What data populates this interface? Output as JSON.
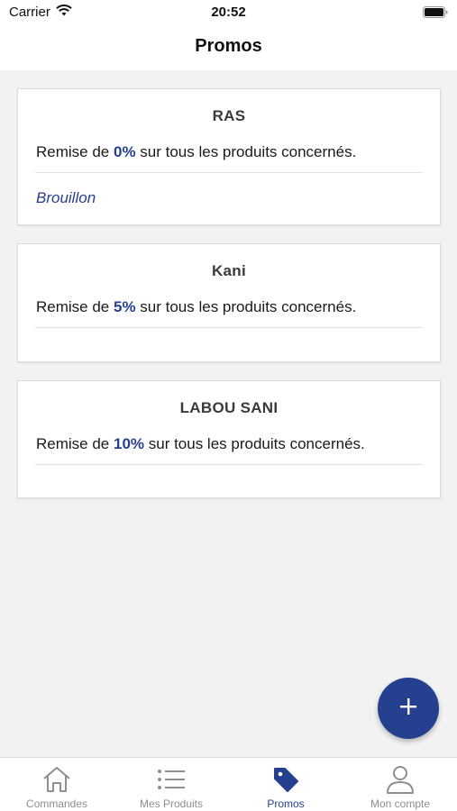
{
  "status_bar": {
    "carrier": "Carrier",
    "time": "20:52"
  },
  "header": {
    "title": "Promos"
  },
  "colors": {
    "accent": "#25408f",
    "inactive": "#8e8e93",
    "background": "#f2f2f2"
  },
  "promos": [
    {
      "name": "RAS",
      "prefix": "Remise de ",
      "percent": "0%",
      "suffix": " sur tous les produits concernés.",
      "status": "Brouillon"
    },
    {
      "name": "Kani",
      "prefix": "Remise de ",
      "percent": "5%",
      "suffix": " sur tous les produits concernés.",
      "status": ""
    },
    {
      "name": "LABOU SANI",
      "prefix": "Remise de ",
      "percent": "10%",
      "suffix": " sur tous les produits concernés.",
      "status": ""
    }
  ],
  "fab": {
    "icon": "plus-icon"
  },
  "tabs": [
    {
      "label": "Commandes",
      "icon": "home-icon"
    },
    {
      "label": "Mes Produits",
      "icon": "list-icon"
    },
    {
      "label": "Promos",
      "icon": "tag-icon",
      "active": true
    },
    {
      "label": "Mon compte",
      "icon": "user-icon"
    }
  ]
}
